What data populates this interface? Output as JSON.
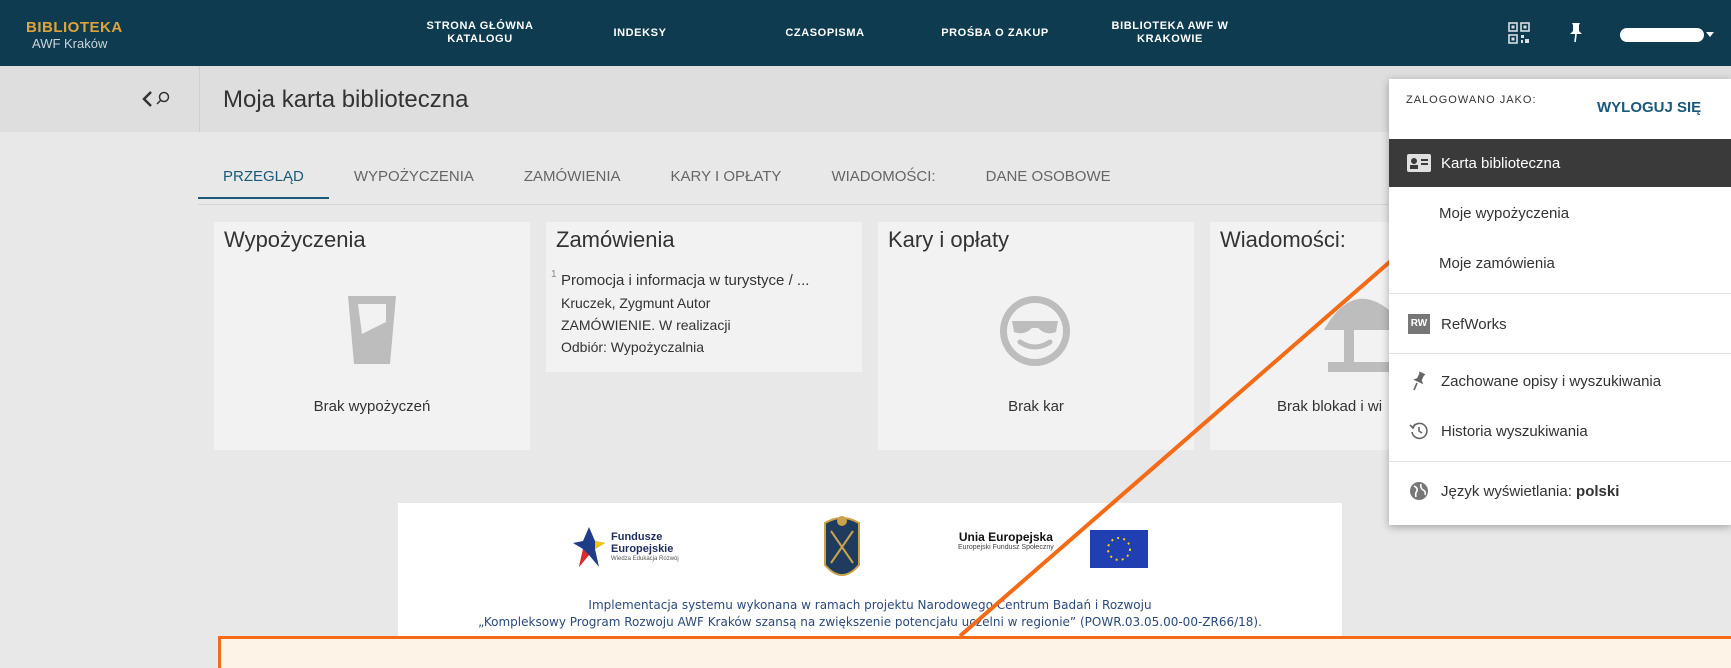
{
  "logo": {
    "line1": "BIBLIOTEKA",
    "line2": "AWF Kraków"
  },
  "nav": [
    {
      "label": "STRONA GŁÓWNA KATALOGU"
    },
    {
      "label": "INDEKSY"
    },
    {
      "label": "CZASOPISMA"
    },
    {
      "label": "PROŚBA O ZAKUP"
    },
    {
      "label": "BIBLIOTEKA AWF W KRAKOWIE"
    }
  ],
  "topbar_icons": [
    "qr-code-icon",
    "pin-icon"
  ],
  "page_title": "Moja karta biblioteczna",
  "tabs": [
    {
      "label": "PRZEGLĄD",
      "active": true
    },
    {
      "label": "WYPOŻYCZENIA"
    },
    {
      "label": "ZAMÓWIENIA"
    },
    {
      "label": "KARY I OPŁATY"
    },
    {
      "label": "WIADOMOŚCI:"
    },
    {
      "label": "DANE OSOBOWE"
    }
  ],
  "cards": {
    "loans": {
      "title": "Wypożyczenia",
      "empty": "Brak wypożyczeń"
    },
    "orders": {
      "title": "Zamówienia",
      "item": {
        "num": "1",
        "title": "Promocja i informacja w turystyce / ...",
        "author": "Kruczek, Zygmunt Autor",
        "status": "ZAMÓWIENIE. W realizacji",
        "pickup": "Odbiór: Wypożyczalnia"
      }
    },
    "fines": {
      "title": "Kary i opłaty",
      "empty": "Brak kar"
    },
    "messages": {
      "title": "Wiadomości:",
      "empty": "Brak blokad i wi"
    }
  },
  "banner": {
    "logo1_line1": "Fundusze",
    "logo1_line2": "Europejskie",
    "logo1_line3": "Wiedza Edukacja Rozwój",
    "logo3_line1": "Unia Europejska",
    "logo3_line2": "Europejski Fundusz Społeczny",
    "line1": "Implementacja systemu wykonana w ramach projektu Narodowego Centrum Badań i Rozwoju",
    "line2": "„Kompleksowy Program Rozwoju AWF Kraków szansą na zwiększenie potencjału uczelni w regionie” (POWR.03.05.00-00-ZR66/18)."
  },
  "dropdown": {
    "logged_as": "ZALOGOWANO JAKO:",
    "logout": "WYLOGUJ SIĘ",
    "items": [
      {
        "label": "Karta biblioteczna",
        "icon": "id-card-icon"
      },
      {
        "label": "Moje wypożyczenia"
      },
      {
        "label": "Moje zamówienia"
      },
      {
        "label": "RefWorks",
        "icon": "refworks-icon",
        "icon_text": "RW"
      },
      {
        "label": "Zachowane opisy i wyszukiwania",
        "icon": "pin-icon"
      },
      {
        "label": "Historia wyszukiwania",
        "icon": "history-icon"
      },
      {
        "label": "Język wyświetlania: ",
        "bold": "polski",
        "icon": "globe-icon"
      }
    ]
  },
  "colors": {
    "topbar": "#0e3b4f",
    "accent": "#1a5a78",
    "annotation": "#f36b16"
  }
}
